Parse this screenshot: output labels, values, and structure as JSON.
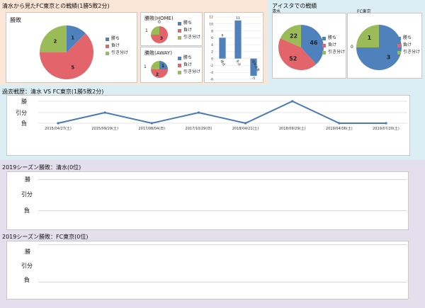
{
  "colors": {
    "top_bg": "#fbe5d6",
    "history_bg": "#dbeef4",
    "season_bg": "#e4dfec",
    "win": "#4f81bd",
    "lose": "#e3646a",
    "draw": "#9bbb59",
    "line": "#4a7ab5"
  },
  "top": {
    "title": "清水から見たFC東京との戦績(1勝5敗2分)",
    "overall": {
      "title": "勝敗",
      "values": {
        "win": 1,
        "lose": 5,
        "draw": 2
      }
    },
    "home": {
      "title": "勝敗(HOME)",
      "values": {
        "win": 0,
        "lose": 3,
        "draw": 1
      },
      "label_top": "0",
      "label_left": "1",
      "label_slice": "3"
    },
    "away": {
      "title": "勝敗(AWAY)",
      "values": {
        "win": 1,
        "lose": 2,
        "draw": 1
      },
      "label_left": "1",
      "label_win": "1",
      "label_lose": "2"
    },
    "legend": {
      "win": "勝ち",
      "lose": "負け",
      "draw": "引き分け"
    }
  },
  "bar_chart": {
    "chart_data": {
      "type": "bar",
      "categories": [
        "得点",
        "失点",
        "得失点差"
      ],
      "values": [
        6,
        11,
        -5
      ],
      "ylim": [
        -6,
        12
      ],
      "yticks": [
        "12",
        "10",
        "8",
        "6",
        "4",
        "2",
        "0",
        "-2",
        "-4",
        "-6"
      ],
      "data_labels": [
        "6",
        "11",
        "-5"
      ]
    }
  },
  "aista": {
    "title": "アイスタでの戦績",
    "shimizu": {
      "title": "清水",
      "values": {
        "win": 46,
        "lose": 52,
        "draw": 22
      }
    },
    "fctokyo": {
      "title": "FC東京",
      "values": {
        "win": 3,
        "lose": 0,
        "draw": 1
      },
      "label_left": "0"
    },
    "legend": {
      "win": "勝ち",
      "lose": "負け",
      "draw": "引き分け"
    }
  },
  "history": {
    "title": "過去戦歴：清水 VS FC東京(1勝5敗2分)",
    "chart_data": {
      "type": "line",
      "x": [
        "2015/04/27(土)",
        "2015/09/29(土)",
        "2017/08/04(日)",
        "2017/10/29(日)",
        "2018/04/21(土)",
        "2018/09/29(土)",
        "2019/04/06(土)",
        "2019/07/20(土)"
      ],
      "y_levels": [
        "勝",
        "引分",
        "負"
      ],
      "values": [
        "負",
        "引分",
        "負",
        "引分",
        "負",
        "勝",
        "負",
        "負"
      ]
    }
  },
  "season1": {
    "title": "2019シーズン勝敗：清水(0位)",
    "y_levels": [
      "勝",
      "引分",
      "負"
    ]
  },
  "season2": {
    "title": "2019シーズン勝敗：FC東京(0位)",
    "y_levels": [
      "勝",
      "引分",
      "負"
    ]
  }
}
